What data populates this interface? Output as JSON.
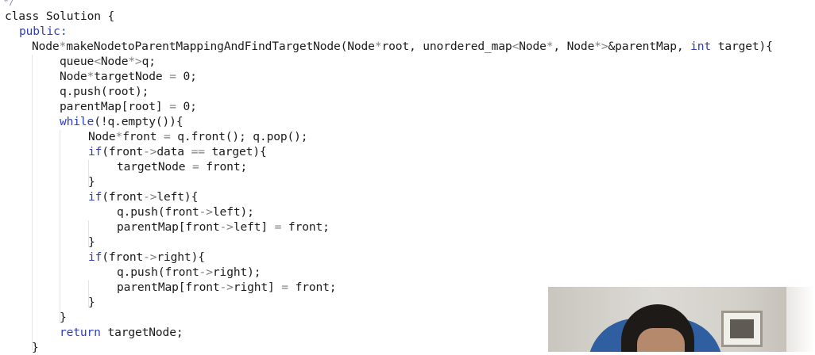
{
  "editor": {
    "top_fragment": "*/",
    "lines": [
      {
        "indent": 0,
        "parts": [
          {
            "t": "class Solution {",
            "c": "plain"
          }
        ]
      },
      {
        "indent": 1,
        "parts": [
          {
            "t": "public:",
            "c": "kw"
          }
        ]
      },
      {
        "indent": 2,
        "parts": [
          {
            "t": "Node",
            "c": "plain"
          },
          {
            "t": "*",
            "c": "op"
          },
          {
            "t": "makeNodetoParentMappingAndFindTargetNode(Node",
            "c": "plain"
          },
          {
            "t": "*",
            "c": "op"
          },
          {
            "t": "root, unordered_map",
            "c": "plain"
          },
          {
            "t": "<",
            "c": "op"
          },
          {
            "t": "Node",
            "c": "plain"
          },
          {
            "t": "*",
            "c": "op"
          },
          {
            "t": ", Node",
            "c": "plain"
          },
          {
            "t": "*>",
            "c": "op"
          },
          {
            "t": "&parentMap, ",
            "c": "plain"
          },
          {
            "t": "int",
            "c": "kw"
          },
          {
            "t": " target){",
            "c": "plain"
          }
        ]
      },
      {
        "indent": 3,
        "parts": [
          {
            "t": "queue",
            "c": "plain"
          },
          {
            "t": "<",
            "c": "op"
          },
          {
            "t": "Node",
            "c": "plain"
          },
          {
            "t": "*>",
            "c": "op"
          },
          {
            "t": "q;",
            "c": "plain"
          }
        ]
      },
      {
        "indent": 3,
        "parts": [
          {
            "t": "Node",
            "c": "plain"
          },
          {
            "t": "*",
            "c": "op"
          },
          {
            "t": "targetNode ",
            "c": "plain"
          },
          {
            "t": "=",
            "c": "op"
          },
          {
            "t": " 0;",
            "c": "plain"
          }
        ]
      },
      {
        "indent": 3,
        "parts": [
          {
            "t": "q.push(root);",
            "c": "plain"
          }
        ]
      },
      {
        "indent": 3,
        "parts": [
          {
            "t": "parentMap[root] ",
            "c": "plain"
          },
          {
            "t": "=",
            "c": "op"
          },
          {
            "t": " 0;",
            "c": "plain"
          }
        ]
      },
      {
        "indent": 3,
        "parts": [
          {
            "t": "while",
            "c": "kw"
          },
          {
            "t": "(!q.empty()){",
            "c": "plain"
          }
        ]
      },
      {
        "indent": 4,
        "parts": [
          {
            "t": "Node",
            "c": "plain"
          },
          {
            "t": "*",
            "c": "op"
          },
          {
            "t": "front ",
            "c": "plain"
          },
          {
            "t": "=",
            "c": "op"
          },
          {
            "t": " q.front(); q.pop();",
            "c": "plain"
          }
        ]
      },
      {
        "indent": 4,
        "parts": [
          {
            "t": "if",
            "c": "kw"
          },
          {
            "t": "(front",
            "c": "plain"
          },
          {
            "t": "->",
            "c": "op"
          },
          {
            "t": "data ",
            "c": "plain"
          },
          {
            "t": "==",
            "c": "op"
          },
          {
            "t": " target){",
            "c": "plain"
          }
        ]
      },
      {
        "indent": 5,
        "parts": [
          {
            "t": "targetNode ",
            "c": "plain"
          },
          {
            "t": "=",
            "c": "op"
          },
          {
            "t": " front;",
            "c": "plain"
          }
        ]
      },
      {
        "indent": 4,
        "parts": [
          {
            "t": "}",
            "c": "plain"
          }
        ]
      },
      {
        "indent": 4,
        "parts": [
          {
            "t": "if",
            "c": "kw"
          },
          {
            "t": "(front",
            "c": "plain"
          },
          {
            "t": "->",
            "c": "op"
          },
          {
            "t": "left){",
            "c": "plain"
          }
        ]
      },
      {
        "indent": 5,
        "parts": [
          {
            "t": "q.push(front",
            "c": "plain"
          },
          {
            "t": "->",
            "c": "op"
          },
          {
            "t": "left);",
            "c": "plain"
          }
        ]
      },
      {
        "indent": 5,
        "parts": [
          {
            "t": "parentMap[front",
            "c": "plain"
          },
          {
            "t": "->",
            "c": "op"
          },
          {
            "t": "left] ",
            "c": "plain"
          },
          {
            "t": "=",
            "c": "op"
          },
          {
            "t": " front;",
            "c": "plain"
          }
        ]
      },
      {
        "indent": 4,
        "parts": [
          {
            "t": "}",
            "c": "plain"
          }
        ]
      },
      {
        "indent": 4,
        "parts": [
          {
            "t": "if",
            "c": "kw"
          },
          {
            "t": "(front",
            "c": "plain"
          },
          {
            "t": "->",
            "c": "op"
          },
          {
            "t": "right){",
            "c": "plain"
          }
        ]
      },
      {
        "indent": 5,
        "parts": [
          {
            "t": "q.push(front",
            "c": "plain"
          },
          {
            "t": "->",
            "c": "op"
          },
          {
            "t": "right);",
            "c": "plain"
          }
        ]
      },
      {
        "indent": 5,
        "parts": [
          {
            "t": "parentMap[front",
            "c": "plain"
          },
          {
            "t": "->",
            "c": "op"
          },
          {
            "t": "right] ",
            "c": "plain"
          },
          {
            "t": "=",
            "c": "op"
          },
          {
            "t": " front;",
            "c": "plain"
          }
        ]
      },
      {
        "indent": 4,
        "parts": [
          {
            "t": "}",
            "c": "plain"
          }
        ]
      },
      {
        "indent": 3,
        "parts": [
          {
            "t": "}",
            "c": "plain"
          }
        ]
      },
      {
        "indent": 3,
        "parts": [
          {
            "t": "return",
            "c": "kw"
          },
          {
            "t": " targetNode;",
            "c": "plain"
          }
        ]
      },
      {
        "indent": 2,
        "parts": [
          {
            "t": "}",
            "c": "plain"
          }
        ]
      }
    ]
  },
  "colors": {
    "keyword": "#2e3dbb",
    "operator": "#7d7d7d",
    "text": "#1b1b1b",
    "background": "#ffffff"
  }
}
